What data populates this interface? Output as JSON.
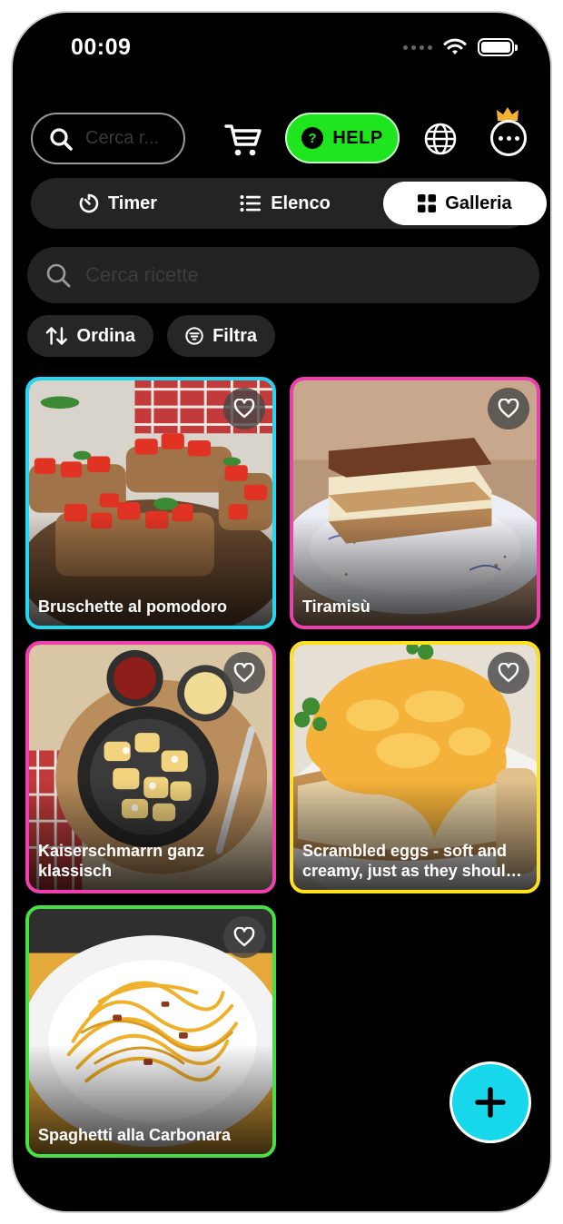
{
  "status_bar": {
    "time": "00:09"
  },
  "toolbar": {
    "search_placeholder": "Cerca r...",
    "help_label": "HELP",
    "help_color": "#1fe51f"
  },
  "tabs": [
    {
      "label": "Timer",
      "icon": "timer-icon",
      "selected": false
    },
    {
      "label": "Elenco",
      "icon": "list-icon",
      "selected": false
    },
    {
      "label": "Galleria",
      "icon": "grid-icon",
      "selected": true
    }
  ],
  "recipe_search": {
    "placeholder": "Cerca ricette"
  },
  "actions": {
    "sort_label": "Ordina",
    "filter_label": "Filtra"
  },
  "recipes": [
    {
      "title": "Bruschette al pomodoro",
      "border": "#22d7f0"
    },
    {
      "title": "Tiramisù",
      "border": "#ef3fae"
    },
    {
      "title": "Kaiserschmarrn ganz klassisch",
      "border": "#ef3fae"
    },
    {
      "title": "Scrambled eggs - soft and creamy, just as they should be",
      "border": "#ffe21a"
    },
    {
      "title": "Spaghetti alla Carbonara",
      "border": "#46e046"
    }
  ],
  "fab": {
    "color": "#17d8ea"
  }
}
